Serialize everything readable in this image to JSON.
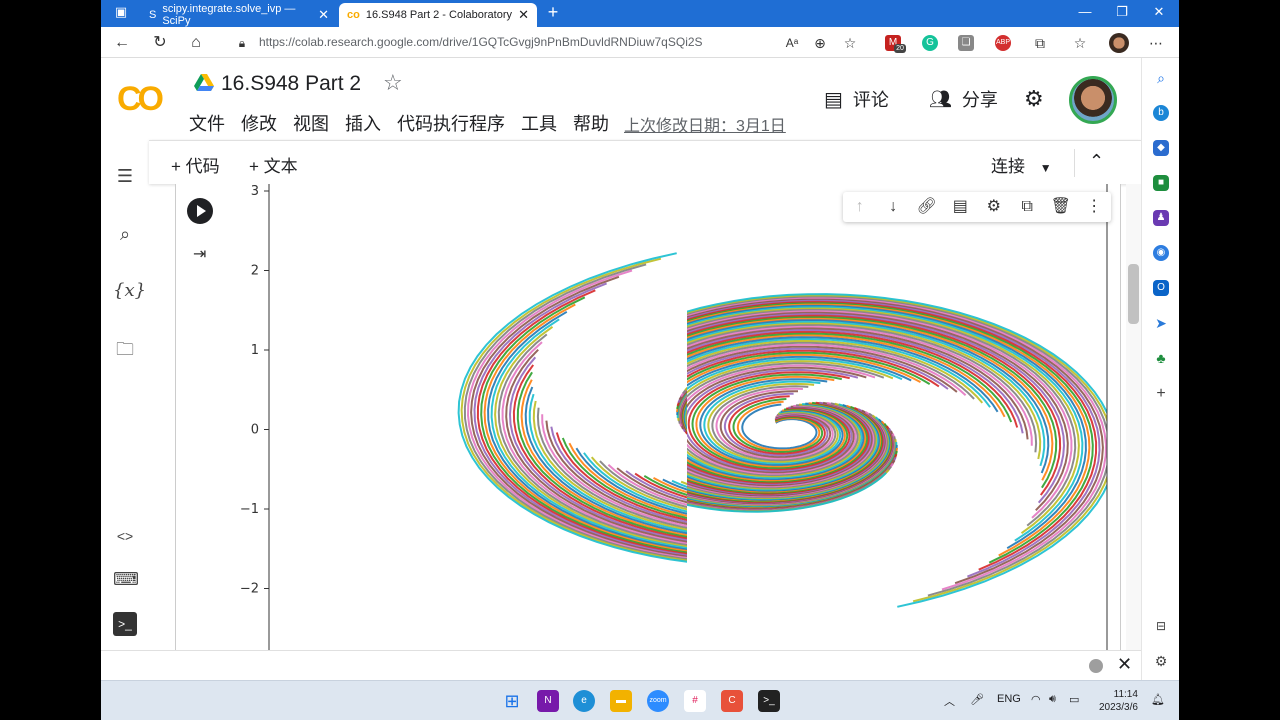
{
  "browser": {
    "tabs": [
      {
        "title": "scipy.integrate.solve_ivp — SciPy",
        "active": false
      },
      {
        "title": "16.S948 Part 2 - Colaboratory",
        "active": true
      }
    ],
    "url": "https://colab.research.google.com/drive/1GQTcGvgj9nPnBmDuvldRNDiuw7qSQi2S",
    "extension_badge": "20"
  },
  "colab": {
    "logo": "CO",
    "title": "16.S948 Part 2",
    "menu": [
      "文件",
      "修改",
      "视图",
      "插入",
      "代码执行程序",
      "工具",
      "帮助"
    ],
    "last_edit": "上次修改日期：3月1日",
    "comment_label": "评论",
    "share_label": "分享",
    "add_code": "+ 代码",
    "add_text": "+ 文本",
    "connect": "连接"
  },
  "chart_data": {
    "type": "line",
    "title": "",
    "xlabel": "",
    "ylabel": "",
    "ylim": [
      -2.7,
      3.1
    ],
    "yticks": [
      "3",
      "2",
      "1",
      "0",
      "−1",
      "−2"
    ],
    "description_series": "many spiral phase-portrait trajectories in a band of colors",
    "colors": [
      "#1f77b4",
      "#ff7f0e",
      "#2ca02c",
      "#d62728",
      "#9467bd",
      "#8c564b",
      "#e377c2",
      "#7f7f7f",
      "#bcbd22",
      "#17becf"
    ]
  },
  "taskbar": {
    "lang": "ENG",
    "time": "11:14",
    "date": "2023/3/6"
  }
}
